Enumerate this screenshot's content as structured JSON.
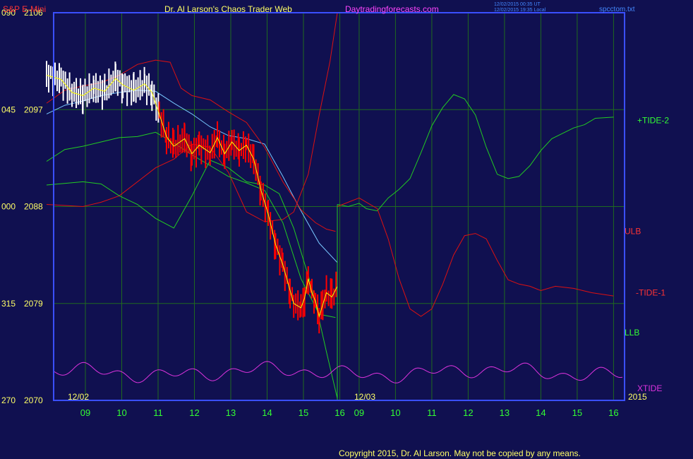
{
  "header": {
    "symbol": "S&P E-Mini",
    "title": "Dr. Al Larson's Chaos Trader Web",
    "site": "Daytradingforecasts.com",
    "time_utc": "12/02/2015 00:35 UT",
    "time_local": "12/02/2015 19:35 Local",
    "file": "spcctom.txt"
  },
  "footer": {
    "copyright": "Copyright 2015, Dr. Al Larson. May not be copied by any means."
  },
  "colors": {
    "background": "#101050",
    "frame": "#3a4fff",
    "price": "#ff0000",
    "yellow": "#ffff00",
    "ma": "#78c8ff",
    "green": "#22cc22",
    "red_line": "#dd1111",
    "magenta": "#dd33dd",
    "label_yellow": "#ffff66",
    "label_red": "#ff3333",
    "label_green": "#33ff33"
  },
  "chart_data": {
    "type": "line",
    "title": "S&P E-Mini",
    "xlabel": "",
    "ylabel": "",
    "ylim": [
      2070,
      2106
    ],
    "xlim": [
      8.4,
      16.0
    ],
    "grid": true,
    "y_ticks": [
      {
        "angle": "090",
        "price": 2106
      },
      {
        "angle": "045",
        "price": 2097
      },
      {
        "angle": "000",
        "price": 2088
      },
      {
        "angle": "315",
        "price": 2079
      },
      {
        "angle": "270",
        "price": 2070
      }
    ],
    "x_ticks_day1": [
      "09",
      "10",
      "11",
      "12",
      "13",
      "14",
      "15",
      "16"
    ],
    "x_ticks_day2": [
      "09",
      "10",
      "11",
      "12",
      "13",
      "14",
      "15",
      "16"
    ],
    "x_tick_values": [
      9,
      10,
      11,
      12,
      13,
      14,
      15,
      16
    ],
    "date_labels": {
      "day1": "12/02",
      "day2": "12/03",
      "year": "2015"
    },
    "series": [
      {
        "name": "+TIDE-2",
        "role": "forecast",
        "color": "green",
        "label_y": 2096,
        "points": [
          [
            0,
            2088.2
          ],
          [
            0.3,
            2088.0
          ],
          [
            0.6,
            2088.3
          ],
          [
            0.8,
            2087.8
          ],
          [
            1.1,
            2087.6
          ],
          [
            1.4,
            2088.8
          ],
          [
            1.7,
            2089.6
          ],
          [
            2.0,
            2090.6
          ],
          [
            2.3,
            2093.0
          ],
          [
            2.6,
            2095.5
          ],
          [
            2.9,
            2097.2
          ],
          [
            3.2,
            2098.4
          ],
          [
            3.5,
            2098.0
          ],
          [
            3.8,
            2096.5
          ],
          [
            4.1,
            2093.5
          ],
          [
            4.4,
            2091.0
          ],
          [
            4.7,
            2090.6
          ],
          [
            5.0,
            2090.8
          ],
          [
            5.3,
            2091.8
          ],
          [
            5.6,
            2093.2
          ],
          [
            5.9,
            2094.3
          ],
          [
            6.2,
            2094.8
          ],
          [
            6.5,
            2095.3
          ],
          [
            6.8,
            2095.6
          ],
          [
            7.1,
            2096.2
          ],
          [
            7.6,
            2096.3
          ]
        ]
      },
      {
        "name": "-TIDE-1",
        "role": "forecast",
        "color": "red",
        "label_y": 2080,
        "points": [
          [
            0,
            2088.0
          ],
          [
            0.3,
            2088.4
          ],
          [
            0.6,
            2088.8
          ],
          [
            0.8,
            2088.4
          ],
          [
            1.1,
            2087.8
          ],
          [
            1.4,
            2085.0
          ],
          [
            1.7,
            2081.3
          ],
          [
            2.0,
            2078.5
          ],
          [
            2.3,
            2077.8
          ],
          [
            2.6,
            2078.5
          ],
          [
            2.9,
            2080.8
          ],
          [
            3.2,
            2083.5
          ],
          [
            3.5,
            2085.3
          ],
          [
            3.8,
            2085.5
          ],
          [
            4.1,
            2085.0
          ],
          [
            4.4,
            2083.0
          ],
          [
            4.7,
            2081.2
          ],
          [
            5.0,
            2080.8
          ],
          [
            5.3,
            2080.6
          ],
          [
            5.6,
            2080.2
          ],
          [
            6.0,
            2080.6
          ],
          [
            6.5,
            2080.4
          ],
          [
            7.0,
            2080.0
          ],
          [
            7.6,
            2079.7
          ]
        ]
      },
      {
        "name": "ULB",
        "role": "band",
        "color": "red",
        "label_y": 2085.7,
        "points": [
          [
            -8,
            2097.6
          ],
          [
            -7.5,
            2098.8
          ],
          [
            -7,
            2099.2
          ],
          [
            -6.5,
            2099.5
          ],
          [
            -6,
            2100.2
          ],
          [
            -5.5,
            2101.2
          ],
          [
            -5,
            2101.6
          ],
          [
            -4.6,
            2101.4
          ],
          [
            -4.3,
            2099.0
          ],
          [
            -4,
            2098.3
          ],
          [
            -3.5,
            2097.9
          ],
          [
            -3,
            2096.8
          ],
          [
            -2.5,
            2095.8
          ],
          [
            -2,
            2093.5
          ],
          [
            -1.5,
            2090.3
          ],
          [
            -1.2,
            2088.8
          ],
          [
            -1,
            2087.7
          ],
          [
            -0.6,
            2086.5
          ],
          [
            -0.3,
            2085.9
          ],
          [
            -0.05,
            2085.7
          ]
        ]
      },
      {
        "name": "LLB",
        "role": "band",
        "color": "green",
        "label_y": 2076.3,
        "points": [
          [
            -8,
            2092.2
          ],
          [
            -7.5,
            2093.3
          ],
          [
            -7,
            2093.6
          ],
          [
            -6.5,
            2094.0
          ],
          [
            -6,
            2094.4
          ],
          [
            -5.5,
            2094.5
          ],
          [
            -5,
            2094.9
          ],
          [
            -4.5,
            2093.9
          ],
          [
            -4,
            2092.8
          ],
          [
            -3.5,
            2091.8
          ],
          [
            -3,
            2090.8
          ],
          [
            -2.5,
            2090.2
          ],
          [
            -2,
            2089.5
          ],
          [
            -1.5,
            2086.5
          ],
          [
            -1,
            2081.3
          ],
          [
            -0.5,
            2078.0
          ],
          [
            -0.05,
            2077.7
          ]
        ]
      },
      {
        "name": "XTIDE",
        "role": "oscillator",
        "color": "magenta",
        "label_y": 2071.1,
        "base": 2072.6,
        "amp": 0.7
      }
    ],
    "unlabeled_lines": [
      {
        "role": "outer-upper",
        "color": "red",
        "points": [
          [
            -8,
            2088.2
          ],
          [
            -7,
            2088.0
          ],
          [
            -6.5,
            2088.4
          ],
          [
            -6,
            2089.0
          ],
          [
            -5,
            2091.6
          ],
          [
            -4.5,
            2092.4
          ],
          [
            -4,
            2093.8
          ],
          [
            -3.5,
            2093.5
          ],
          [
            -3,
            2091.2
          ],
          [
            -2.5,
            2087.5
          ],
          [
            -2,
            2086.6
          ],
          [
            -1.5,
            2086.8
          ],
          [
            -1.2,
            2087.5
          ],
          [
            -0.8,
            2091.0
          ],
          [
            -0.5,
            2096.5
          ],
          [
            -0.2,
            2101.5
          ],
          [
            0,
            2106.0
          ]
        ]
      },
      {
        "role": "inner-lower",
        "color": "green",
        "points": [
          [
            -8,
            2090.0
          ],
          [
            -7,
            2090.3
          ],
          [
            -6.5,
            2090.1
          ],
          [
            -6,
            2089.0
          ],
          [
            -5.5,
            2088.2
          ],
          [
            -5,
            2086.9
          ],
          [
            -4.5,
            2086.0
          ],
          [
            -4,
            2089.0
          ],
          [
            -3.5,
            2092.3
          ],
          [
            -3,
            2091.6
          ],
          [
            -2.5,
            2090.3
          ],
          [
            -2,
            2090.0
          ],
          [
            -1.6,
            2089.2
          ],
          [
            -1.2,
            2086.0
          ],
          [
            -0.7,
            2080.5
          ],
          [
            -0.3,
            2074.5
          ],
          [
            0,
            2070.2
          ]
        ]
      },
      {
        "role": "moving-average",
        "color": "lightblue",
        "points": [
          [
            -8,
            2096.6
          ],
          [
            -7.5,
            2097.4
          ],
          [
            -7,
            2097.8
          ],
          [
            -6.5,
            2098.3
          ],
          [
            -6,
            2098.6
          ],
          [
            -5.5,
            2098.8
          ],
          [
            -5,
            2098.7
          ],
          [
            -4.5,
            2097.6
          ],
          [
            -4,
            2096.6
          ],
          [
            -3.5,
            2095.4
          ],
          [
            -3,
            2094.6
          ],
          [
            -2.5,
            2094.3
          ],
          [
            -2,
            2093.8
          ],
          [
            -1.5,
            2090.8
          ],
          [
            -1,
            2087.6
          ],
          [
            -0.5,
            2084.6
          ],
          [
            0,
            2082.8
          ]
        ]
      }
    ],
    "price_path": [
      [
        -8,
        2100.2
      ],
      [
        -7.6,
        2099.8
      ],
      [
        -7.3,
        2098.6
      ],
      [
        -7.0,
        2098.3
      ],
      [
        -6.7,
        2099.0
      ],
      [
        -6.4,
        2098.7
      ],
      [
        -6.1,
        2099.9
      ],
      [
        -5.9,
        2099.3
      ],
      [
        -5.6,
        2098.8
      ],
      [
        -5.3,
        2099.4
      ],
      [
        -5.1,
        2098.6
      ],
      [
        -4.9,
        2096.6
      ],
      [
        -4.7,
        2094.5
      ],
      [
        -4.5,
        2093.6
      ],
      [
        -4.2,
        2094.3
      ],
      [
        -4.0,
        2092.9
      ],
      [
        -3.8,
        2093.7
      ],
      [
        -3.5,
        2093.0
      ],
      [
        -3.3,
        2094.4
      ],
      [
        -3.1,
        2092.9
      ],
      [
        -2.9,
        2094.0
      ],
      [
        -2.7,
        2093.2
      ],
      [
        -2.5,
        2093.7
      ],
      [
        -2.3,
        2092.4
      ],
      [
        -2.1,
        2089.5
      ],
      [
        -1.9,
        2087.3
      ],
      [
        -1.7,
        2084.5
      ],
      [
        -1.5,
        2082.6
      ],
      [
        -1.3,
        2080.2
      ],
      [
        -1.2,
        2079.0
      ],
      [
        -1.0,
        2078.6
      ],
      [
        -0.9,
        2079.5
      ],
      [
        -0.8,
        2081.3
      ],
      [
        -0.7,
        2080.0
      ],
      [
        -0.6,
        2079.2
      ],
      [
        -0.5,
        2077.8
      ],
      [
        -0.4,
        2078.9
      ],
      [
        -0.3,
        2080.0
      ],
      [
        -0.15,
        2079.6
      ],
      [
        0,
        2080.6
      ]
    ]
  },
  "markers": [
    {
      "type": "vertical",
      "x": 0,
      "color": "green"
    }
  ],
  "side_labels": [
    "+TIDE-2",
    "ULB",
    "-TIDE-1",
    "LLB",
    "XTIDE"
  ]
}
